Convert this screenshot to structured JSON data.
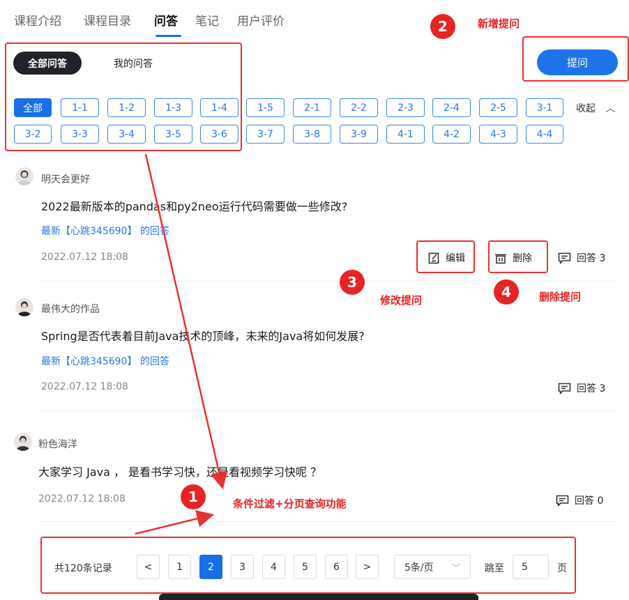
{
  "tabs": [
    {
      "label": "课程介绍"
    },
    {
      "label": "课程目录"
    },
    {
      "label": "问答"
    },
    {
      "label": "笔记"
    },
    {
      "label": "用户评价"
    }
  ],
  "filter": {
    "all_questions": "全部问答",
    "my_questions": "我的问答",
    "ask_button": "提问",
    "collapse": "收起",
    "chips": [
      "全部",
      "1-1",
      "1-2",
      "1-3",
      "1-4",
      "1-5",
      "2-1",
      "2-2",
      "2-3",
      "2-4",
      "2-5",
      "3-1",
      "3-2",
      "3-3",
      "3-4",
      "3-5",
      "3-6",
      "3-7",
      "3-8",
      "3-9",
      "4-1",
      "4-2",
      "4-3",
      "4-4"
    ]
  },
  "questions": [
    {
      "user": "明天会更好",
      "title": "2022最新版本的pandas和py2neo运行代码需要做一些修改?",
      "latest": "最新【心跳345690】 的回答",
      "date": "2022.07.12  18:08",
      "edit": "编辑",
      "delete": "删除",
      "answers": "回答 3"
    },
    {
      "user": "最伟大的作品",
      "title": "Spring是否代表着目前Java技术的顶峰，未来的Java将如何发展?",
      "latest": "最新【心跳345690】 的回答",
      "date": "2022.07.12  18:08",
      "answers": "回答 3"
    },
    {
      "user": "粉色海洋",
      "title": "大家学习 Java ， 是看书学习快，还是看视频学习快呢 ？",
      "date": "2022.07.12  18:08",
      "answers": "回答 0"
    }
  ],
  "pagination": {
    "total": "共120条记录",
    "prev": "<",
    "next": ">",
    "pages": [
      "1",
      "2",
      "3",
      "4",
      "5",
      "6"
    ],
    "current": "2",
    "page_size": "5条/页",
    "jump_label": "跳至",
    "jump_value": "5",
    "page_unit": "页"
  },
  "annotations": {
    "a1": {
      "num": "1",
      "text": "条件过滤+分页查询功能"
    },
    "a2": {
      "num": "2",
      "text": "新增提问"
    },
    "a3": {
      "num": "3",
      "text": "修改提问"
    },
    "a4": {
      "num": "4",
      "text": "删除提问"
    }
  },
  "colors": {
    "accent": "#1a6fe8",
    "annotation": "#e82323",
    "dark_pill": "#1f2229"
  }
}
